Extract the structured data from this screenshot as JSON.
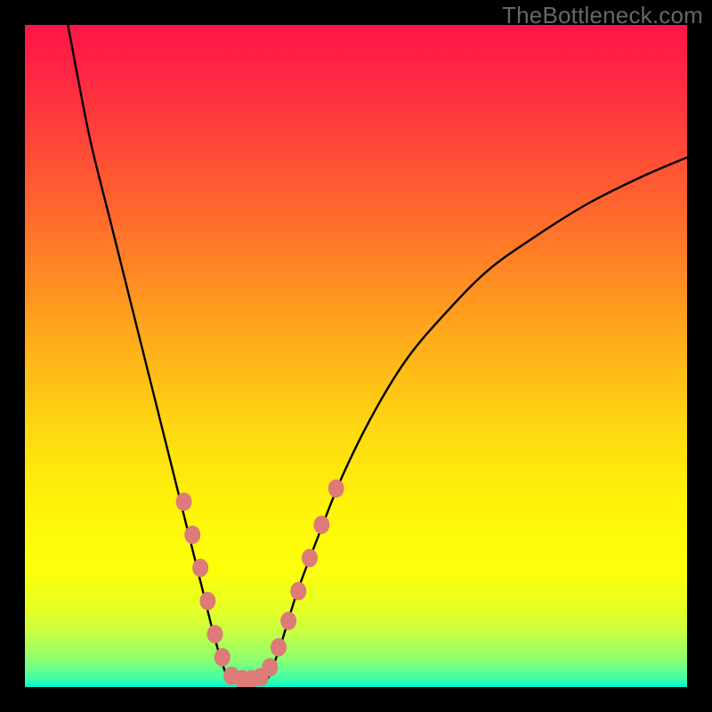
{
  "watermark": "TheBottleneck.com",
  "chart_data": {
    "type": "line",
    "title": "",
    "xlabel": "",
    "ylabel": "",
    "xlim": [
      0,
      100
    ],
    "ylim": [
      0,
      100
    ],
    "background_gradient": {
      "top": "#ff134a",
      "mid1": "#ffa31d",
      "mid2": "#fff30a",
      "bottom": "#00f8d0"
    },
    "series": [
      {
        "name": "left-branch",
        "stroke": "#000000",
        "points": [
          {
            "x": 6.5,
            "y": 100
          },
          {
            "x": 8.0,
            "y": 92
          },
          {
            "x": 10.0,
            "y": 82
          },
          {
            "x": 13.0,
            "y": 70
          },
          {
            "x": 16.0,
            "y": 58
          },
          {
            "x": 19.0,
            "y": 46
          },
          {
            "x": 21.5,
            "y": 36
          },
          {
            "x": 24.0,
            "y": 26
          },
          {
            "x": 26.5,
            "y": 16
          },
          {
            "x": 28.5,
            "y": 8
          },
          {
            "x": 30.0,
            "y": 3
          },
          {
            "x": 31.0,
            "y": 1
          }
        ]
      },
      {
        "name": "trough",
        "stroke": "#000000",
        "points": [
          {
            "x": 31.0,
            "y": 1
          },
          {
            "x": 33.0,
            "y": 0.5
          },
          {
            "x": 35.0,
            "y": 0.5
          },
          {
            "x": 36.5,
            "y": 1
          }
        ]
      },
      {
        "name": "right-branch",
        "stroke": "#000000",
        "points": [
          {
            "x": 36.5,
            "y": 1
          },
          {
            "x": 38.5,
            "y": 6
          },
          {
            "x": 41.0,
            "y": 14
          },
          {
            "x": 44.0,
            "y": 22
          },
          {
            "x": 48.0,
            "y": 32
          },
          {
            "x": 53.0,
            "y": 42
          },
          {
            "x": 58.0,
            "y": 50
          },
          {
            "x": 64.0,
            "y": 57
          },
          {
            "x": 70.0,
            "y": 63
          },
          {
            "x": 77.0,
            "y": 68
          },
          {
            "x": 85.0,
            "y": 73
          },
          {
            "x": 93.0,
            "y": 77
          },
          {
            "x": 100.0,
            "y": 80
          }
        ]
      }
    ],
    "markers": {
      "name": "highlight-dots",
      "fill": "#dd7b78",
      "radius_px": 9,
      "points": [
        {
          "x": 24.0,
          "y": 28
        },
        {
          "x": 25.3,
          "y": 23
        },
        {
          "x": 26.5,
          "y": 18
        },
        {
          "x": 27.6,
          "y": 13
        },
        {
          "x": 28.7,
          "y": 8
        },
        {
          "x": 29.8,
          "y": 4.5
        },
        {
          "x": 31.2,
          "y": 1.7
        },
        {
          "x": 32.8,
          "y": 1.2
        },
        {
          "x": 34.2,
          "y": 1.2
        },
        {
          "x": 35.6,
          "y": 1.5
        },
        {
          "x": 37.0,
          "y": 3
        },
        {
          "x": 38.3,
          "y": 6
        },
        {
          "x": 39.8,
          "y": 10
        },
        {
          "x": 41.3,
          "y": 14.5
        },
        {
          "x": 43.0,
          "y": 19.5
        },
        {
          "x": 44.8,
          "y": 24.5
        },
        {
          "x": 47.0,
          "y": 30
        }
      ]
    }
  }
}
